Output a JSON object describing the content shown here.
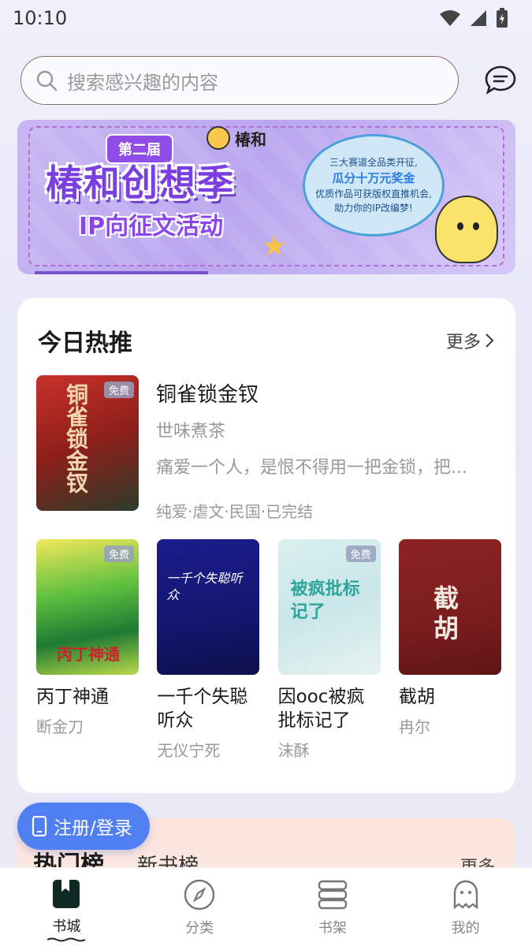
{
  "status_bar": {
    "time": "10:10"
  },
  "search": {
    "placeholder": "搜索感兴趣的内容"
  },
  "banner": {
    "edition": "第二届",
    "brand": "椿和",
    "title": "椿和创想季",
    "subtitle": "IP向征文活动",
    "bubble_line1": "三大赛道全品类开征,",
    "bubble_line2": "瓜分十万元奖金",
    "bubble_line3": "优质作品可获版权直推机会,",
    "bubble_line4": "助力你的IP改编梦!"
  },
  "today_hot": {
    "title": "今日热推",
    "more": "更多",
    "featured": {
      "title": "铜雀锁金钗",
      "author": "世味煮茶",
      "desc": "痛爱一个人，是恨不得用一把金锁，把...",
      "tags": "纯爱·虐文·民国·已完结",
      "free_tag": "免费",
      "cover_text": "铜雀锁金钗"
    },
    "books": [
      {
        "title": "丙丁神通",
        "author": "断金刀",
        "free_tag": "免费",
        "cover_text": "丙丁神通"
      },
      {
        "title": "一千个失聪听众",
        "author": "无仪宁死",
        "free_tag": "",
        "cover_text": "一千个失聪听众"
      },
      {
        "title": "因ooc被疯批标记了",
        "author": "沫酥",
        "free_tag": "免费",
        "cover_text": "被疯批标记了"
      },
      {
        "title": "截胡",
        "author": "冉尔",
        "free_tag": "",
        "cover_text": "截胡"
      }
    ]
  },
  "login_button": "注册/登录",
  "rank": {
    "tab_hot": "热门榜",
    "tab_new": "新书榜",
    "more": "更多"
  },
  "nav": {
    "home": "书城",
    "category": "分类",
    "shelf": "书架",
    "mine": "我的"
  },
  "colors": {
    "accent": "#4f7ff0",
    "banner": "#b9a6ef",
    "title": "#7b3fe0"
  }
}
